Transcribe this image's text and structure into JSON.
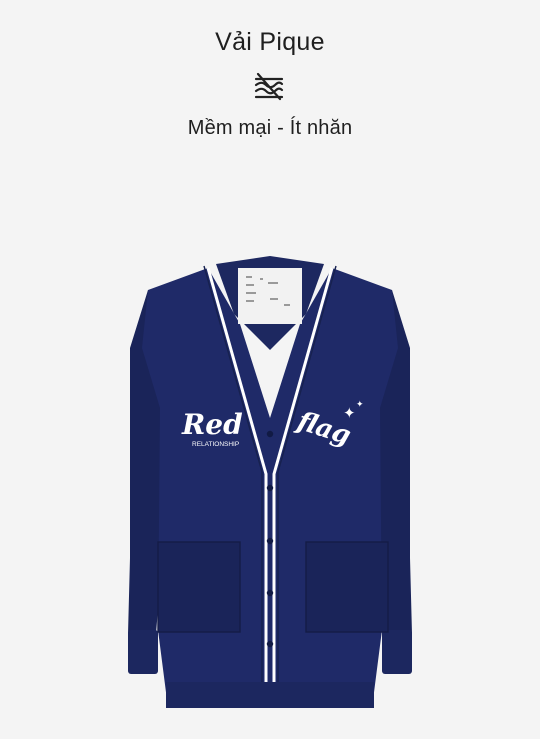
{
  "feature": {
    "title": "Vải Pique",
    "icon": "no-wrinkle-icon",
    "subtitle": "Mềm mại - Ít nhăn"
  },
  "product": {
    "image": "navy-cardigan-image",
    "print_left": "Red",
    "print_left_small": "RELATIONSHIP",
    "print_right": "flag",
    "color": "#1d2863",
    "trim_color": "#ffffff"
  }
}
